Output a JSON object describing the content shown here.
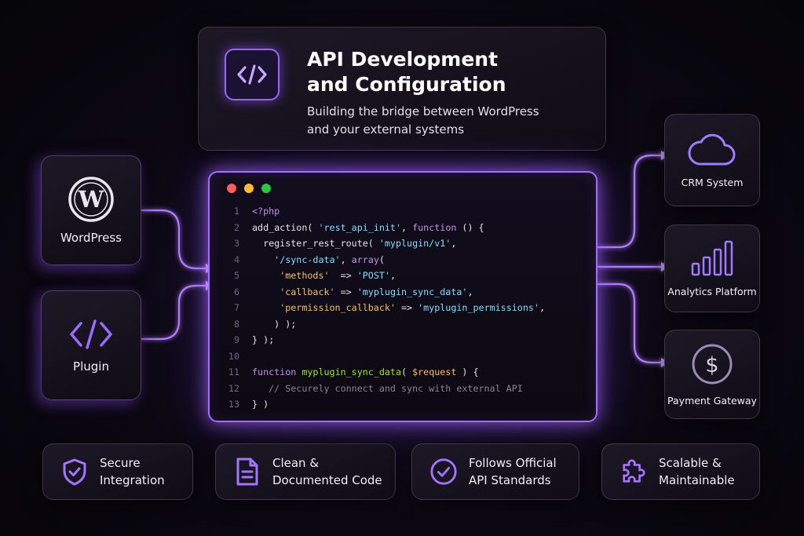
{
  "header": {
    "icon": "code-brackets-icon",
    "title_line1": "API Development",
    "title_line2": "and Configuration",
    "subtitle_line1": "Building the bridge between WordPress",
    "subtitle_line2": "and your external systems"
  },
  "sources": [
    {
      "label": "WordPress",
      "icon": "wordpress-logo-icon"
    },
    {
      "label": "Plugin",
      "icon": "code-brackets-icon"
    }
  ],
  "destinations": [
    {
      "label": "CRM System",
      "icon": "cloud-icon"
    },
    {
      "label": "Analytics Platform",
      "icon": "bar-chart-icon"
    },
    {
      "label": "Payment Gateway",
      "icon": "dollar-coin-icon"
    }
  ],
  "code": {
    "window_dots": [
      "#ff5f57",
      "#febc2e",
      "#28c840"
    ],
    "lines": [
      {
        "n": "1",
        "tokens": [
          {
            "t": "<?php",
            "c": "#c792ea"
          }
        ]
      },
      {
        "n": "2",
        "tokens": [
          {
            "t": "add_action( ",
            "c": "#e6e3ee"
          },
          {
            "t": "'rest_api_init'",
            "c": "#89ddff"
          },
          {
            "t": ", ",
            "c": "#e6e3ee"
          },
          {
            "t": "function",
            "c": "#c792ea"
          },
          {
            "t": " () {",
            "c": "#e6e3ee"
          }
        ]
      },
      {
        "n": "3",
        "tokens": [
          {
            "t": "  register_rest_route( ",
            "c": "#e6e3ee"
          },
          {
            "t": "'myplugin/v1'",
            "c": "#89ddff"
          },
          {
            "t": ",",
            "c": "#e6e3ee"
          }
        ]
      },
      {
        "n": "4",
        "tokens": [
          {
            "t": "    ",
            "c": "#e6e3ee"
          },
          {
            "t": "'/sync-data'",
            "c": "#89ddff"
          },
          {
            "t": ", ",
            "c": "#e6e3ee"
          },
          {
            "t": "array",
            "c": "#c792ea"
          },
          {
            "t": "(",
            "c": "#e6e3ee"
          }
        ]
      },
      {
        "n": "5",
        "tokens": [
          {
            "t": "     ",
            "c": "#e6e3ee"
          },
          {
            "t": "'methods'",
            "c": "#f5c06b"
          },
          {
            "t": "  => ",
            "c": "#e6e3ee"
          },
          {
            "t": "'POST'",
            "c": "#89ddff"
          },
          {
            "t": ",",
            "c": "#e6e3ee"
          }
        ]
      },
      {
        "n": "6",
        "tokens": [
          {
            "t": "     ",
            "c": "#e6e3ee"
          },
          {
            "t": "'callback'",
            "c": "#f5c06b"
          },
          {
            "t": " => ",
            "c": "#e6e3ee"
          },
          {
            "t": "'myplugin_sync_data'",
            "c": "#89ddff"
          },
          {
            "t": ",",
            "c": "#e6e3ee"
          }
        ]
      },
      {
        "n": "7",
        "tokens": [
          {
            "t": "     ",
            "c": "#e6e3ee"
          },
          {
            "t": "'permission_callback'",
            "c": "#f5c06b"
          },
          {
            "t": " => ",
            "c": "#e6e3ee"
          },
          {
            "t": "'myplugin_permissions'",
            "c": "#89ddff"
          },
          {
            "t": ",",
            "c": "#e6e3ee"
          }
        ]
      },
      {
        "n": "8",
        "tokens": [
          {
            "t": "    ) );",
            "c": "#e6e3ee"
          }
        ]
      },
      {
        "n": "9",
        "tokens": [
          {
            "t": "} );",
            "c": "#e6e3ee"
          }
        ]
      },
      {
        "n": "10",
        "tokens": []
      },
      {
        "n": "11",
        "tokens": [
          {
            "t": "function",
            "c": "#c792ea"
          },
          {
            "t": " ",
            "c": "#e6e3ee"
          },
          {
            "t": "myplugin_sync_data",
            "c": "#a6e22e"
          },
          {
            "t": "( ",
            "c": "#e6e3ee"
          },
          {
            "t": "$request",
            "c": "#f5c06b"
          },
          {
            "t": " ) {",
            "c": "#e6e3ee"
          }
        ]
      },
      {
        "n": "12",
        "tokens": [
          {
            "t": "   // Securely connect and sync with external API",
            "c": "#8a8399"
          }
        ]
      },
      {
        "n": "13",
        "tokens": [
          {
            "t": "} )",
            "c": "#e6e3ee"
          }
        ]
      }
    ]
  },
  "features": [
    {
      "line1": "Secure",
      "line2": "Integration",
      "icon": "shield-check-icon"
    },
    {
      "line1": "Clean &",
      "line2": "Documented Code",
      "icon": "document-icon"
    },
    {
      "line1": "Follows Official",
      "line2": "API Standards",
      "icon": "check-circle-icon"
    },
    {
      "line1": "Scalable &",
      "line2": "Maintainable",
      "icon": "puzzle-icon"
    }
  ],
  "colors": {
    "accent": "#a46dff",
    "glow": "#8b4dff"
  }
}
